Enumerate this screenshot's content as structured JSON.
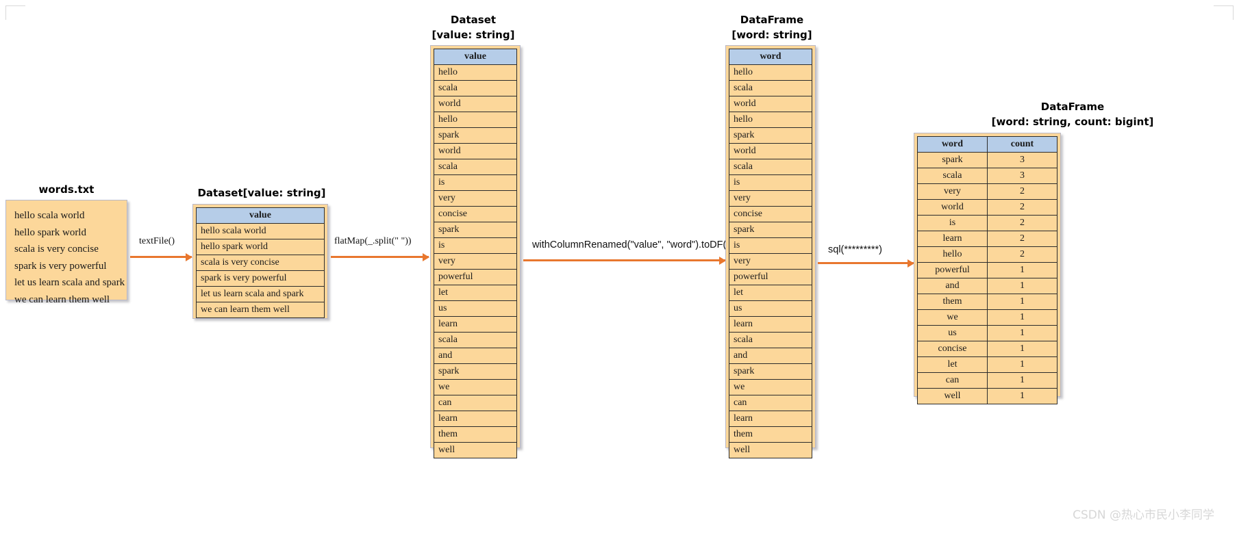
{
  "diagram": {
    "watermark": "CSDN @热心市民小李同学",
    "captions": {
      "note": "words.txt",
      "dataset_value_flat": "Dataset[value: string]",
      "dataset_value": "Dataset\n[value: string]",
      "dataframe_word": "DataFrame\n[word: string]",
      "dataframe_word_count": "DataFrame\n[word: string, count: bigint]"
    },
    "arrows": [
      {
        "label": "textFile()"
      },
      {
        "label": "flatMap(_.split(\" \"))"
      },
      {
        "label": "withColumnRenamed(\"value\", \"word\").toDF()"
      },
      {
        "label": "sql(*********)"
      }
    ],
    "note_lines": [
      "hello scala world",
      "hello spark world",
      "scala is very concise",
      "spark is very powerful",
      "let us learn scala and spark",
      "we can learn them well"
    ],
    "table_lines": {
      "header": "value",
      "rows": [
        "hello scala world",
        "hello spark world",
        "scala is very concise",
        "spark is very powerful",
        "let us learn scala and spark",
        "we can learn them well"
      ]
    },
    "table_words_value": {
      "header": "value",
      "rows": [
        "hello",
        "scala",
        "world",
        "hello",
        "spark",
        "world",
        "scala",
        "is",
        "very",
        "concise",
        "spark",
        "is",
        "very",
        "powerful",
        "let",
        "us",
        "learn",
        "scala",
        "and",
        "spark",
        "we",
        "can",
        "learn",
        "them",
        "well"
      ]
    },
    "table_words_word": {
      "header": "word",
      "rows": [
        "hello",
        "scala",
        "world",
        "hello",
        "spark",
        "world",
        "scala",
        "is",
        "very",
        "concise",
        "spark",
        "is",
        "very",
        "powerful",
        "let",
        "us",
        "learn",
        "scala",
        "and",
        "spark",
        "we",
        "can",
        "learn",
        "them",
        "well"
      ]
    },
    "table_counts": {
      "headers": [
        "word",
        "count"
      ],
      "rows": [
        [
          "spark",
          "3"
        ],
        [
          "scala",
          "3"
        ],
        [
          "very",
          "2"
        ],
        [
          "world",
          "2"
        ],
        [
          "is",
          "2"
        ],
        [
          "learn",
          "2"
        ],
        [
          "hello",
          "2"
        ],
        [
          "powerful",
          "1"
        ],
        [
          "and",
          "1"
        ],
        [
          "them",
          "1"
        ],
        [
          "we",
          "1"
        ],
        [
          "us",
          "1"
        ],
        [
          "concise",
          "1"
        ],
        [
          "let",
          "1"
        ],
        [
          "can",
          "1"
        ],
        [
          "well",
          "1"
        ]
      ]
    },
    "colors": {
      "cell_fill": "#fcd79a",
      "header_fill": "#b6cde8",
      "arrow": "#e8772e",
      "border": "#2b2b2b"
    }
  }
}
